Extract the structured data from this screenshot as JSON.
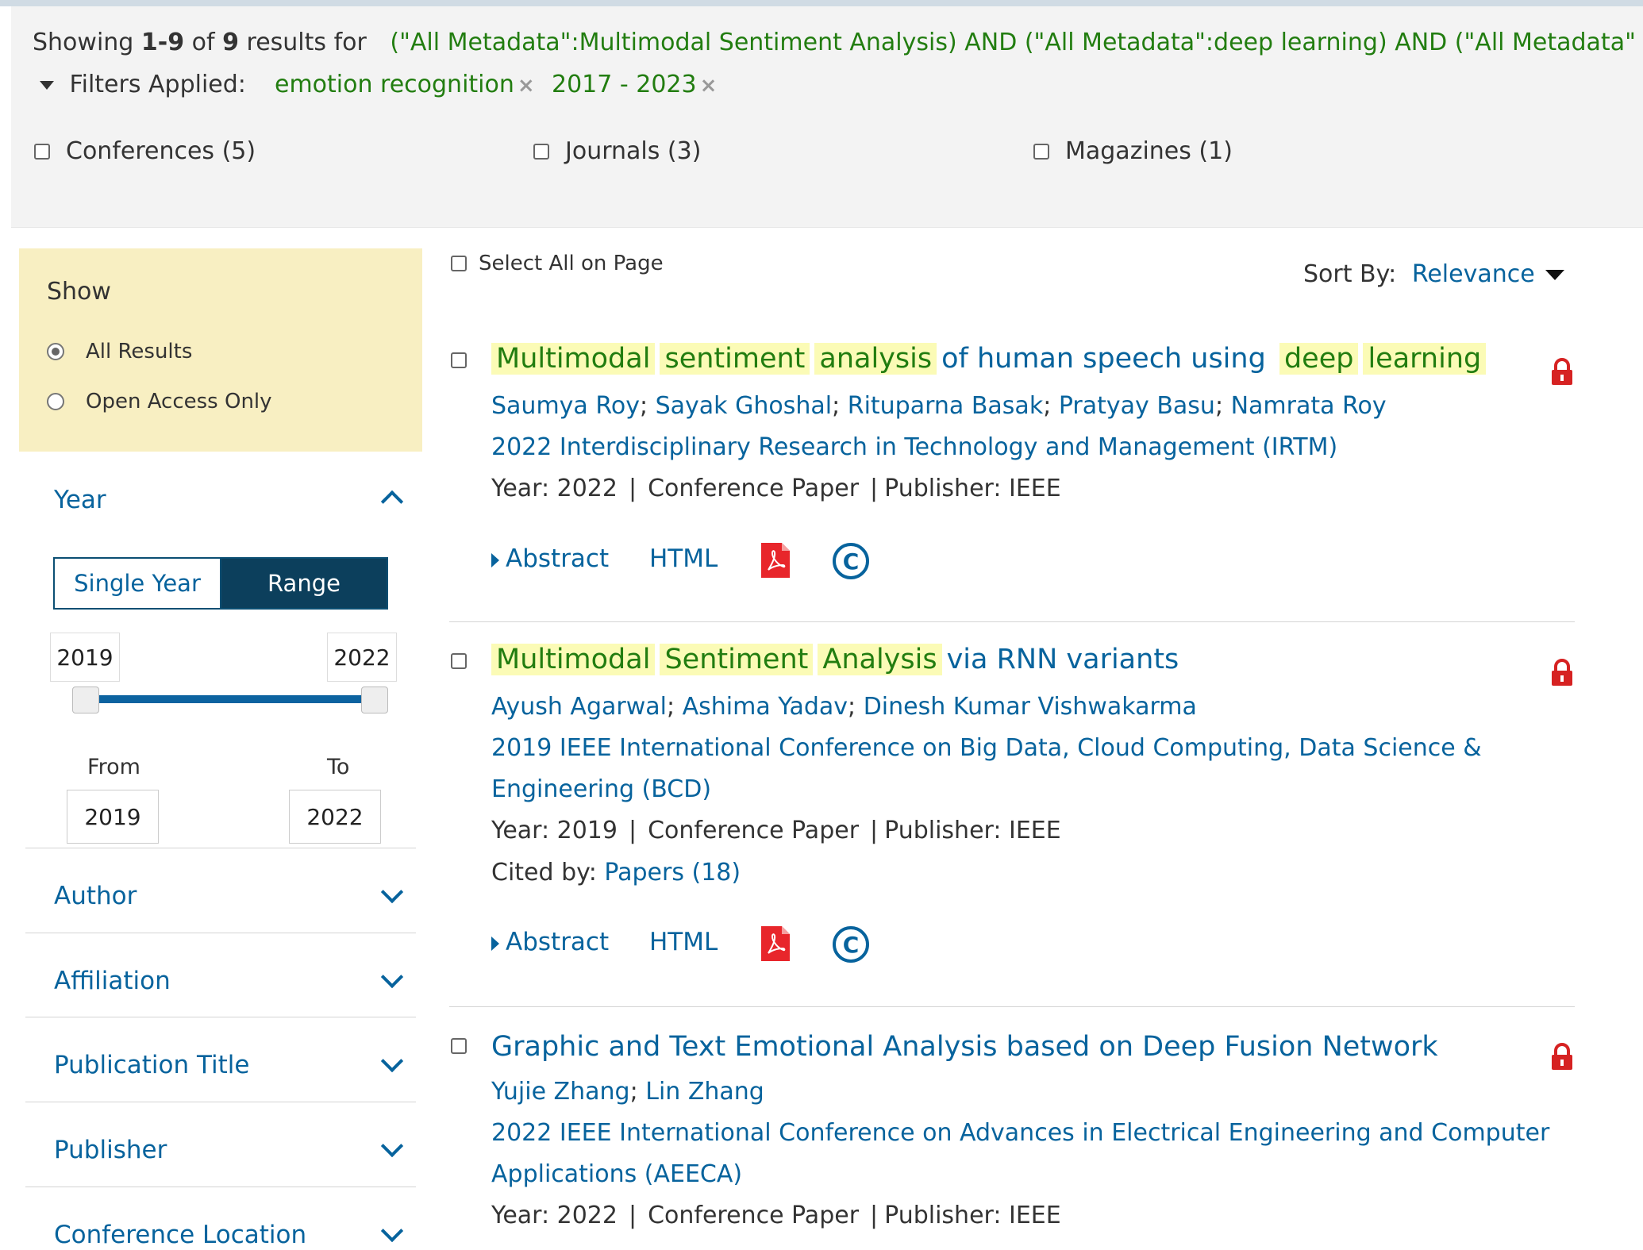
{
  "summary": {
    "showing_label": "Showing",
    "range": "1-9",
    "of_label": "of",
    "total": "9",
    "results_for_label": "results for",
    "query": "(\"All Metadata\":Multimodal Sentiment Analysis) AND (\"All Metadata\":deep learning) AND (\"All Metadata\"",
    "filters_label": "Filters Applied:",
    "filters": [
      "emotion recognition",
      "2017 - 2023"
    ],
    "content_types": [
      "Conferences (5)",
      "Journals (3)",
      "Magazines (1)"
    ]
  },
  "sidebar": {
    "show_title": "Show",
    "show_options": [
      "All Results",
      "Open Access Only"
    ],
    "year": {
      "title": "Year",
      "single_label": "Single Year",
      "range_label": "Range",
      "min": "2019",
      "max": "2022",
      "from_label": "From",
      "to_label": "To",
      "from_value": "2019",
      "to_value": "2022",
      "slider_fraction_start": 0.0,
      "slider_fraction_end": 1.0
    },
    "facets": [
      "Author",
      "Affiliation",
      "Publication Title",
      "Publisher",
      "Conference Location"
    ]
  },
  "toolbar": {
    "select_all_label": "Select All on Page",
    "sort_label": "Sort By:",
    "sort_value": "Relevance"
  },
  "results": [
    {
      "title_highlights": [
        "Multimodal",
        "sentiment",
        "analysis"
      ],
      "title_mid": "of human speech using",
      "title_highlights2": [
        "deep",
        "learning"
      ],
      "authors": [
        "Saumya Roy",
        "Sayak Ghoshal",
        "Rituparna Basak",
        "Pratyay Basu",
        "Namrata Roy"
      ],
      "venue": "2022 Interdisciplinary Research in Technology and Management (IRTM)",
      "year_text": "Year: 2022",
      "type": "Conference Paper",
      "publisher_text": "Publisher:  IEEE"
    },
    {
      "title_highlights": [
        "Multimodal",
        "Sentiment",
        "Analysis"
      ],
      "title_rest": "via RNN variants",
      "authors": [
        "Ayush Agarwal",
        "Ashima Yadav",
        "Dinesh Kumar Vishwakarma"
      ],
      "venue_line1": "2019 IEEE International Conference on Big Data, Cloud Computing, Data Science &",
      "venue_line2": "Engineering (BCD)",
      "year_text": "Year: 2019",
      "type": "Conference Paper",
      "publisher_text": "Publisher:  IEEE",
      "cited_label": "Cited by:",
      "cited_value": "Papers (18)"
    },
    {
      "title": "Graphic and Text Emotional Analysis based on Deep Fusion Network",
      "authors": [
        "Yujie Zhang",
        "Lin Zhang"
      ],
      "venue_line1": "2022 IEEE International Conference on Advances in Electrical Engineering and Computer",
      "venue_line2": "Applications (AEECA)",
      "year_text": "Year: 2022",
      "type": "Conference Paper",
      "publisher_text": "Publisher:  IEEE"
    }
  ],
  "actions": {
    "abstract_label": "Abstract",
    "html_label": "HTML",
    "copyright_glyph": "C"
  },
  "colors": {
    "link_blue": "#07639d",
    "query_green": "#227d10",
    "highlight_yellow": "#fbfbb6",
    "show_panel": "#f8efc2",
    "range_active": "#0c3f5c",
    "lock_red": "#d62222",
    "pdf_red": "#e8262b"
  }
}
